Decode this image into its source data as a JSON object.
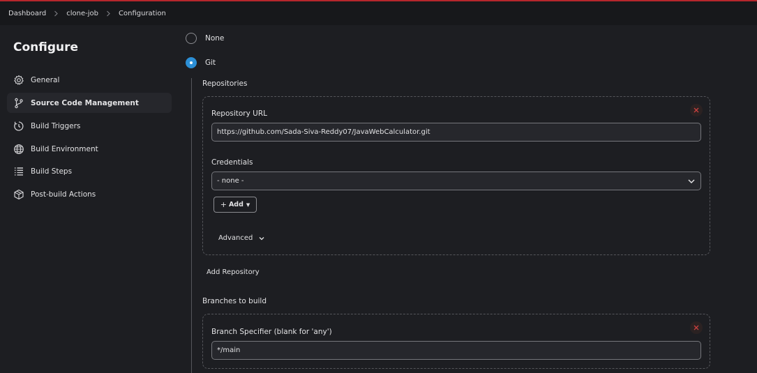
{
  "breadcrumb": {
    "items": [
      "Dashboard",
      "clone-job",
      "Configuration"
    ]
  },
  "page": {
    "title": "Configure"
  },
  "sidebar": {
    "items": [
      {
        "label": "General",
        "icon": "gear-icon"
      },
      {
        "label": "Source Code Management",
        "icon": "branch-icon"
      },
      {
        "label": "Build Triggers",
        "icon": "clock-icon"
      },
      {
        "label": "Build Environment",
        "icon": "globe-icon"
      },
      {
        "label": "Build Steps",
        "icon": "list-icon"
      },
      {
        "label": "Post-build Actions",
        "icon": "package-icon"
      }
    ],
    "active_index": 1
  },
  "scm": {
    "options": [
      {
        "label": "None",
        "checked": false
      },
      {
        "label": "Git",
        "checked": true
      }
    ],
    "repositories_label": "Repositories",
    "repository": {
      "url_label": "Repository URL",
      "url_value": "https://github.com/Sada-Siva-Reddy07/JavaWebCalculator.git",
      "credentials_label": "Credentials",
      "credentials_value": "- none -",
      "add_label": "Add",
      "advanced_label": "Advanced"
    },
    "add_repository_label": "Add Repository",
    "branches_label": "Branches to build",
    "branch": {
      "specifier_label": "Branch Specifier (blank for 'any')",
      "specifier_value": "*/main"
    }
  },
  "colors": {
    "accent": "#2c8fd6",
    "top_line": "#b7262c",
    "delete_icon": "#c9403f",
    "background": "#1d1e22"
  }
}
